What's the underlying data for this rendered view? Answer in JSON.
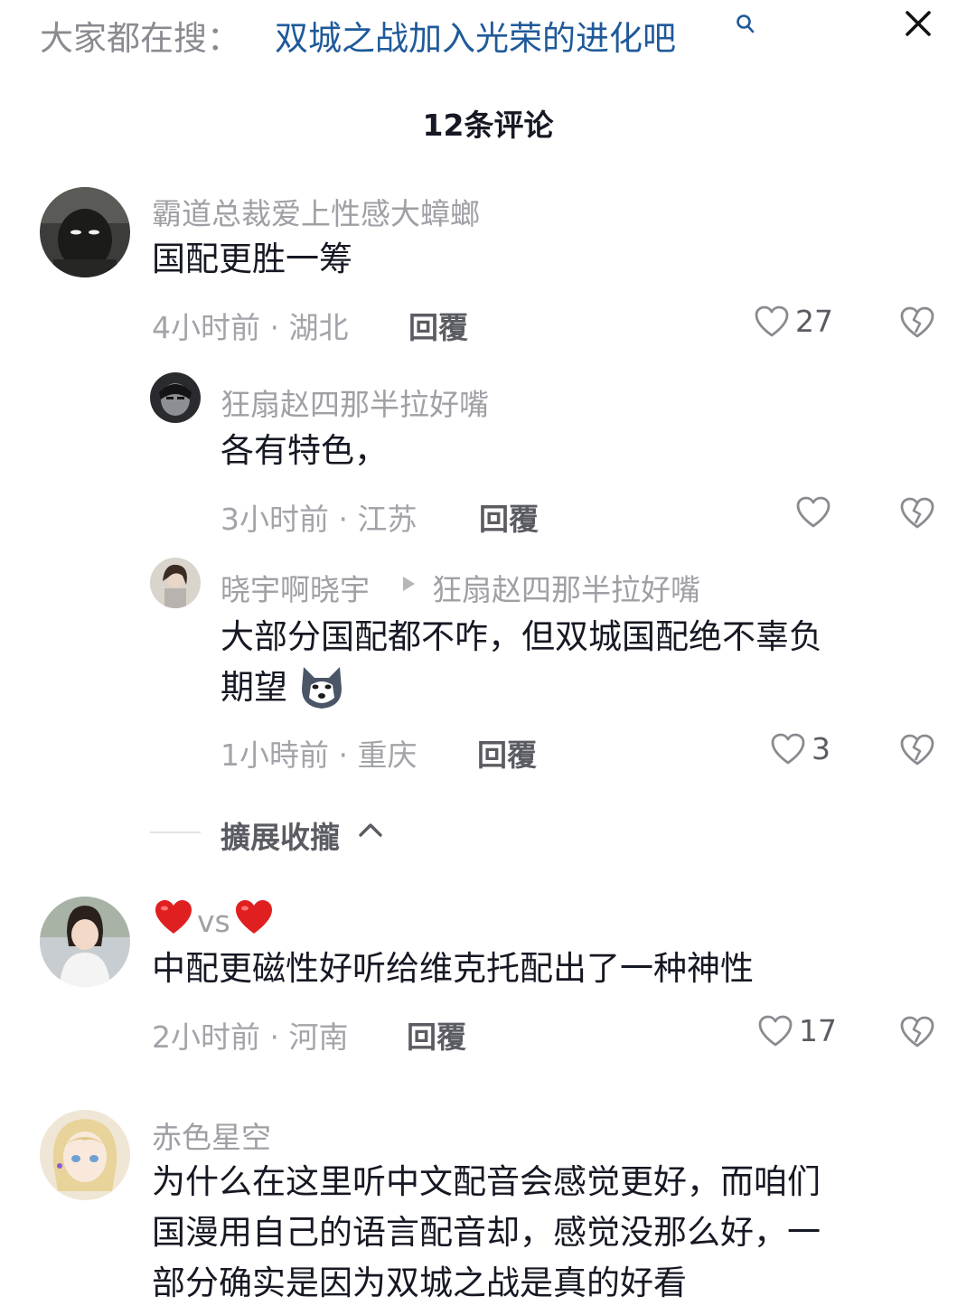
{
  "search": {
    "prefix": "大家都在搜：",
    "query": "双城之战加入光荣的进化吧"
  },
  "comments_title": "12条评论",
  "comments": [
    {
      "username": "霸道总裁爱上性感大蟑螂",
      "text": "国配更胜一筹",
      "meta": "4小时前 · 湖北",
      "reply": "回覆",
      "likes": "27"
    },
    {
      "username": "狂扇赵四那半拉好嘴",
      "text": "各有特色，",
      "meta": "3小时前 · 江苏",
      "reply": "回覆"
    },
    {
      "username": "晓宇啊晓宇",
      "reply_to": "狂扇赵四那半拉好嘴",
      "text_line1": "大部分国配都不咋，但双城国配绝不辜负",
      "text_line2": "期望",
      "meta": "1小時前 · 重庆",
      "reply": "回覆",
      "likes": "3"
    },
    {
      "username_vs": "vs",
      "text": "中配更磁性好听给维克托配出了一种神性",
      "meta": "2小时前 · 河南",
      "reply": "回覆",
      "likes": "17"
    },
    {
      "username": "赤色星空",
      "text_line1": "为什么在这里听中文配音会感觉更好，而咱们",
      "text_line2": "国漫用自己的语言配音却，感觉没那么好，一",
      "text_line3": "部分确实是因为双城之战是真的好看"
    }
  ],
  "collapse_label": "擴展收攏",
  "colors": {
    "link": "#1f5a9a",
    "text": "#161823",
    "muted": "#a3a4a9",
    "heart_red": "#e02020"
  }
}
